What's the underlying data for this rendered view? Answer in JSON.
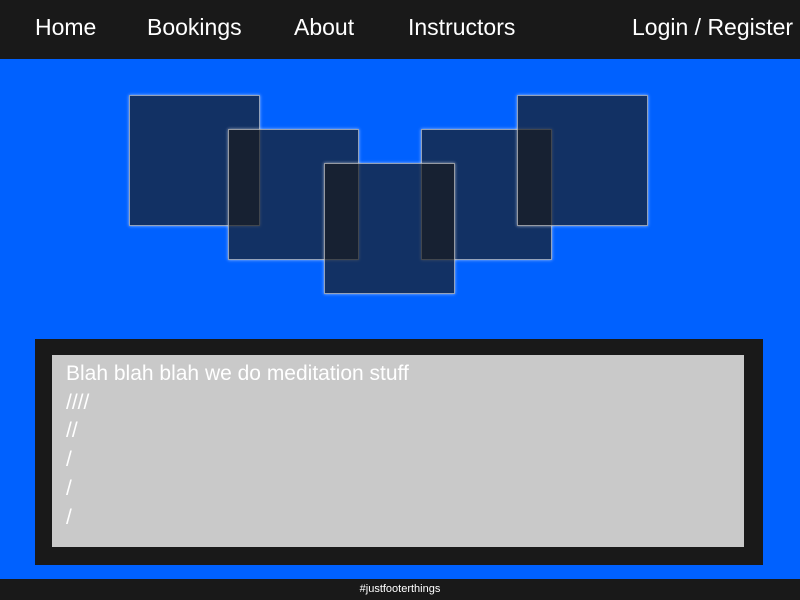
{
  "nav": {
    "home": "Home",
    "bookings": "Bookings",
    "about": "About",
    "instructors": "Instructors",
    "login": "Login / Register"
  },
  "content": {
    "lines": [
      "Blah blah blah we do meditation stuff",
      "////",
      "//",
      "/",
      "/",
      "/"
    ]
  },
  "footer": {
    "text": "#justfooterthings"
  },
  "colors": {
    "page_background": "#0061ff",
    "bar_background": "#191919",
    "panel_background": "#c9c9c9",
    "text": "#ffffff"
  }
}
